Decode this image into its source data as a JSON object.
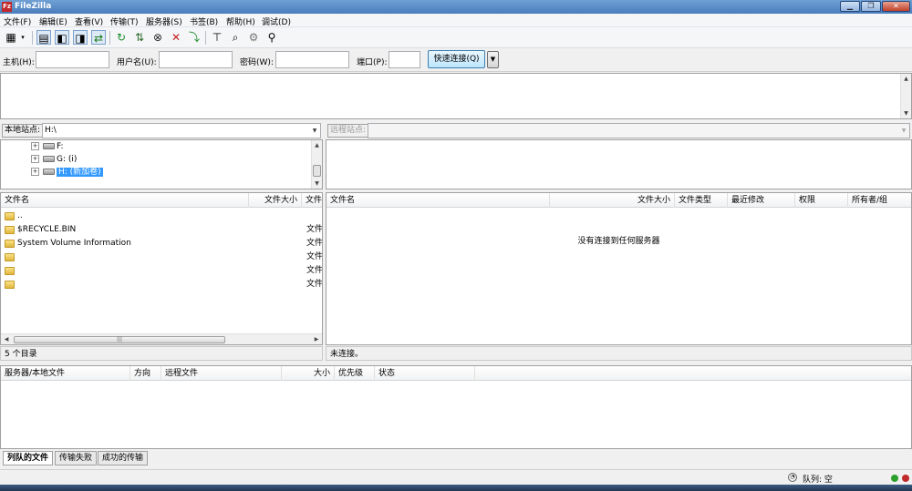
{
  "window": {
    "title": "FileZilla",
    "app_icon": "Fz"
  },
  "menu": [
    "文件(F)",
    "编辑(E)",
    "查看(V)",
    "传输(T)",
    "服务器(S)",
    "书签(B)",
    "帮助(H)",
    "调试(D)"
  ],
  "quickconnect": {
    "host_label": "主机(H):",
    "user_label": "用户名(U):",
    "pass_label": "密码(W):",
    "port_label": "端口(P):",
    "host_value": "",
    "user_value": "",
    "pass_value": "",
    "port_value": "",
    "connect_label": "快速连接(Q)"
  },
  "local": {
    "site_label": "本地站点:",
    "path": "H:\\",
    "tree": [
      {
        "label": "F:"
      },
      {
        "label": "G: (i)"
      },
      {
        "label": "H: (新加卷)"
      }
    ],
    "columns": {
      "name": "文件名",
      "size": "文件大小",
      "type": "文件"
    },
    "files": [
      {
        "name": "..",
        "type": ""
      },
      {
        "name": "$RECYCLE.BIN",
        "type": "文件"
      },
      {
        "name": "System Volume Information",
        "type": "文件"
      },
      {
        "name": "",
        "type": "文件"
      },
      {
        "name": "",
        "type": "文件"
      },
      {
        "name": "",
        "type": "文件"
      }
    ],
    "status": "5 个目录"
  },
  "remote": {
    "site_label": "远程站点:",
    "path": "",
    "columns": {
      "name": "文件名",
      "size": "文件大小",
      "type": "文件类型",
      "modified": "最近修改",
      "perms": "权限",
      "owner": "所有者/组"
    },
    "empty_message": "没有连接到任何服务器",
    "status": "未连接。"
  },
  "queue": {
    "columns": {
      "server": "服务器/本地文件",
      "direction": "方向",
      "remote": "远程文件",
      "size": "大小",
      "priority": "优先级",
      "status": "状态"
    },
    "tabs": [
      "列队的文件",
      "传输失败",
      "成功的传输"
    ]
  },
  "statusbar": {
    "queue_text": "队列: 空"
  },
  "colors": {
    "titlebar": "#4a7cbc",
    "selection": "#3399ff",
    "led_green": "#2ca02c",
    "led_red": "#c0282a"
  }
}
